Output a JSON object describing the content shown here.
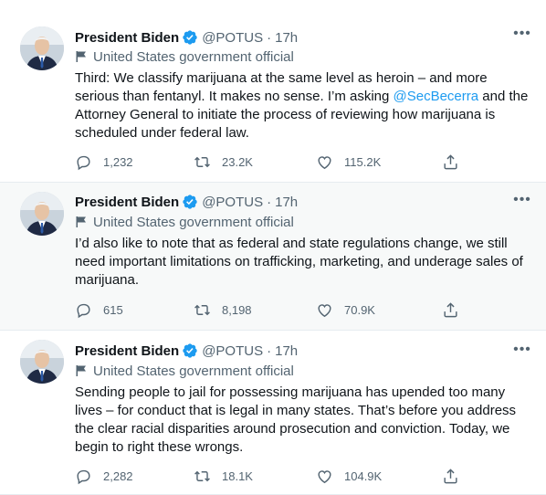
{
  "tweets": [
    {
      "name": "President Biden",
      "handle": "@POTUS",
      "separator": "·",
      "time": "17h",
      "gov_label": "United States government official",
      "text_before": "Third: We classify marijuana at the same level as heroin – and more serious than fentanyl. It makes no sense. I’m asking ",
      "mention": "@SecBecerra",
      "text_after": " and the Attorney General to initiate the process of reviewing how marijuana is scheduled under federal law.",
      "replies": "1,232",
      "retweets": "23.2K",
      "likes": "115.2K"
    },
    {
      "name": "President Biden",
      "handle": "@POTUS",
      "separator": "·",
      "time": "17h",
      "gov_label": "United States government official",
      "text_before": "I’d also like to note that as federal and state regulations change, we still need important limitations on trafficking, marketing, and underage sales of marijuana.",
      "mention": "",
      "text_after": "",
      "replies": "615",
      "retweets": "8,198",
      "likes": "70.9K"
    },
    {
      "name": "President Biden",
      "handle": "@POTUS",
      "separator": "·",
      "time": "17h",
      "gov_label": "United States government official",
      "text_before": "Sending people to jail for possessing marijuana has upended too many lives – for conduct that is legal in many states. That’s before you address the clear racial disparities around prosecution and conviction. Today, we begin to right these wrongs.",
      "mention": "",
      "text_after": "",
      "replies": "2,282",
      "retweets": "18.1K",
      "likes": "104.9K"
    }
  ],
  "icons": {
    "verified": "verified-badge-icon",
    "gov": "flag-icon",
    "reply": "reply-icon",
    "retweet": "retweet-icon",
    "like": "heart-icon",
    "share": "share-icon",
    "more": "more-icon"
  },
  "colors": {
    "accent": "#1d9bf0",
    "muted": "#536471",
    "text": "#0f1419",
    "highlight_bg": "#f7f9f9"
  }
}
